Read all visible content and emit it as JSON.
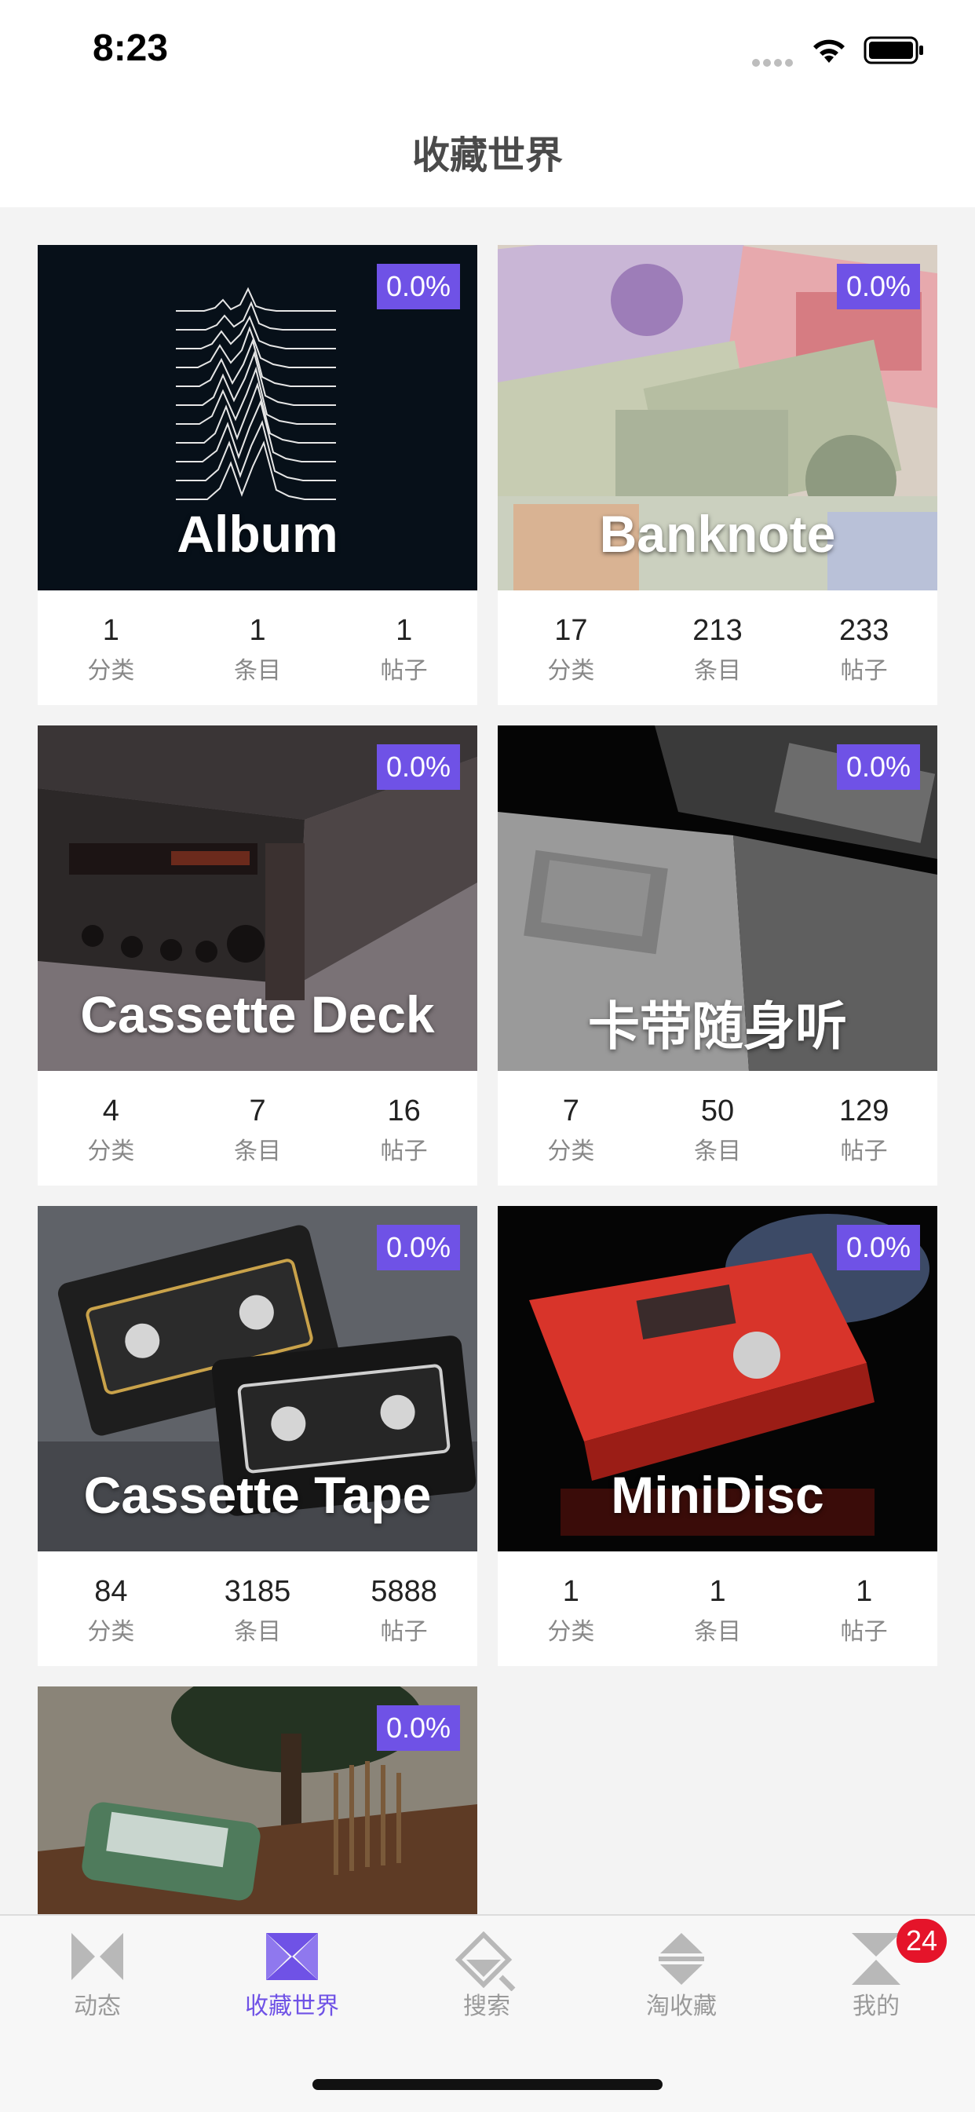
{
  "status_bar": {
    "time": "8:23"
  },
  "header": {
    "title": "收藏世界"
  },
  "cards": [
    {
      "title": "Album",
      "badge": "0.0%",
      "stats": [
        {
          "value": "1",
          "label": "分类"
        },
        {
          "value": "1",
          "label": "条目"
        },
        {
          "value": "1",
          "label": "帖子"
        }
      ]
    },
    {
      "title": "Banknote",
      "badge": "0.0%",
      "stats": [
        {
          "value": "17",
          "label": "分类"
        },
        {
          "value": "213",
          "label": "条目"
        },
        {
          "value": "233",
          "label": "帖子"
        }
      ]
    },
    {
      "title": "Cassette Deck",
      "badge": "0.0%",
      "stats": [
        {
          "value": "4",
          "label": "分类"
        },
        {
          "value": "7",
          "label": "条目"
        },
        {
          "value": "16",
          "label": "帖子"
        }
      ]
    },
    {
      "title": "卡带随身听",
      "badge": "0.0%",
      "stats": [
        {
          "value": "7",
          "label": "分类"
        },
        {
          "value": "50",
          "label": "条目"
        },
        {
          "value": "129",
          "label": "帖子"
        }
      ]
    },
    {
      "title": "Cassette Tape",
      "badge": "0.0%",
      "stats": [
        {
          "value": "84",
          "label": "分类"
        },
        {
          "value": "3185",
          "label": "条目"
        },
        {
          "value": "5888",
          "label": "帖子"
        }
      ]
    },
    {
      "title": "MiniDisc",
      "badge": "0.0%",
      "stats": [
        {
          "value": "1",
          "label": "分类"
        },
        {
          "value": "1",
          "label": "条目"
        },
        {
          "value": "1",
          "label": "帖子"
        }
      ]
    },
    {
      "title": "",
      "badge": "0.0%"
    }
  ],
  "tabs": [
    {
      "label": "动态",
      "icon": "bowtie-icon",
      "active": false
    },
    {
      "label": "收藏世界",
      "icon": "hourglass-x-icon",
      "active": true
    },
    {
      "label": "搜索",
      "icon": "search-diamond-icon",
      "active": false
    },
    {
      "label": "淘收藏",
      "icon": "diamond-stack-icon",
      "active": false
    },
    {
      "label": "我的",
      "icon": "hourglass-icon",
      "active": false
    }
  ],
  "notification_count": "24",
  "colors": {
    "accent": "#6f52e6",
    "badge_red": "#e5142a"
  }
}
